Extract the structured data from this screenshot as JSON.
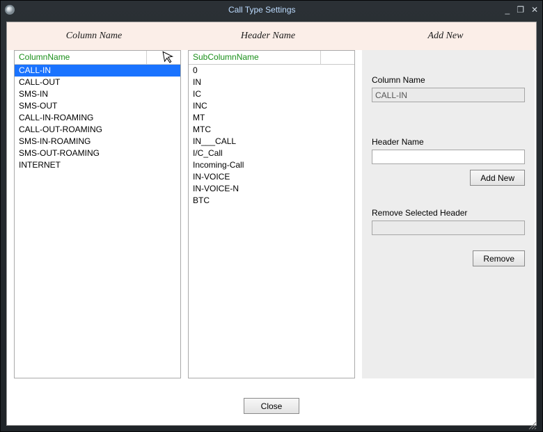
{
  "window": {
    "title": "Call Type Settings",
    "min_icon": "_",
    "max_icon": "❐",
    "close_icon": "✕"
  },
  "section_headers": {
    "col1": "Column Name",
    "col2": "Header Name",
    "col3": "Add New"
  },
  "left_grid": {
    "header": "ColumnName",
    "selected_index": 0,
    "rows": [
      "CALL-IN",
      "CALL-OUT",
      "SMS-IN",
      "SMS-OUT",
      "CALL-IN-ROAMING",
      "CALL-OUT-ROAMING",
      "SMS-IN-ROAMING",
      "SMS-OUT-ROAMING",
      "INTERNET"
    ]
  },
  "middle_grid": {
    "header": "SubColumnName",
    "rows": [
      "0",
      "IN",
      "IC",
      "INC",
      "MT",
      "MTC",
      "IN___CALL",
      "I/C_Call",
      "Incoming-Call",
      "IN-VOICE",
      "IN-VOICE-N",
      "BTC"
    ]
  },
  "form": {
    "column_name_label": "Column Name",
    "column_name_value": "CALL-IN",
    "header_name_label": "Header Name",
    "header_name_value": "",
    "add_new_label": "Add New",
    "remove_section_label": "Remove Selected Header",
    "remove_value": "",
    "remove_button_label": "Remove"
  },
  "footer": {
    "close_label": "Close"
  }
}
